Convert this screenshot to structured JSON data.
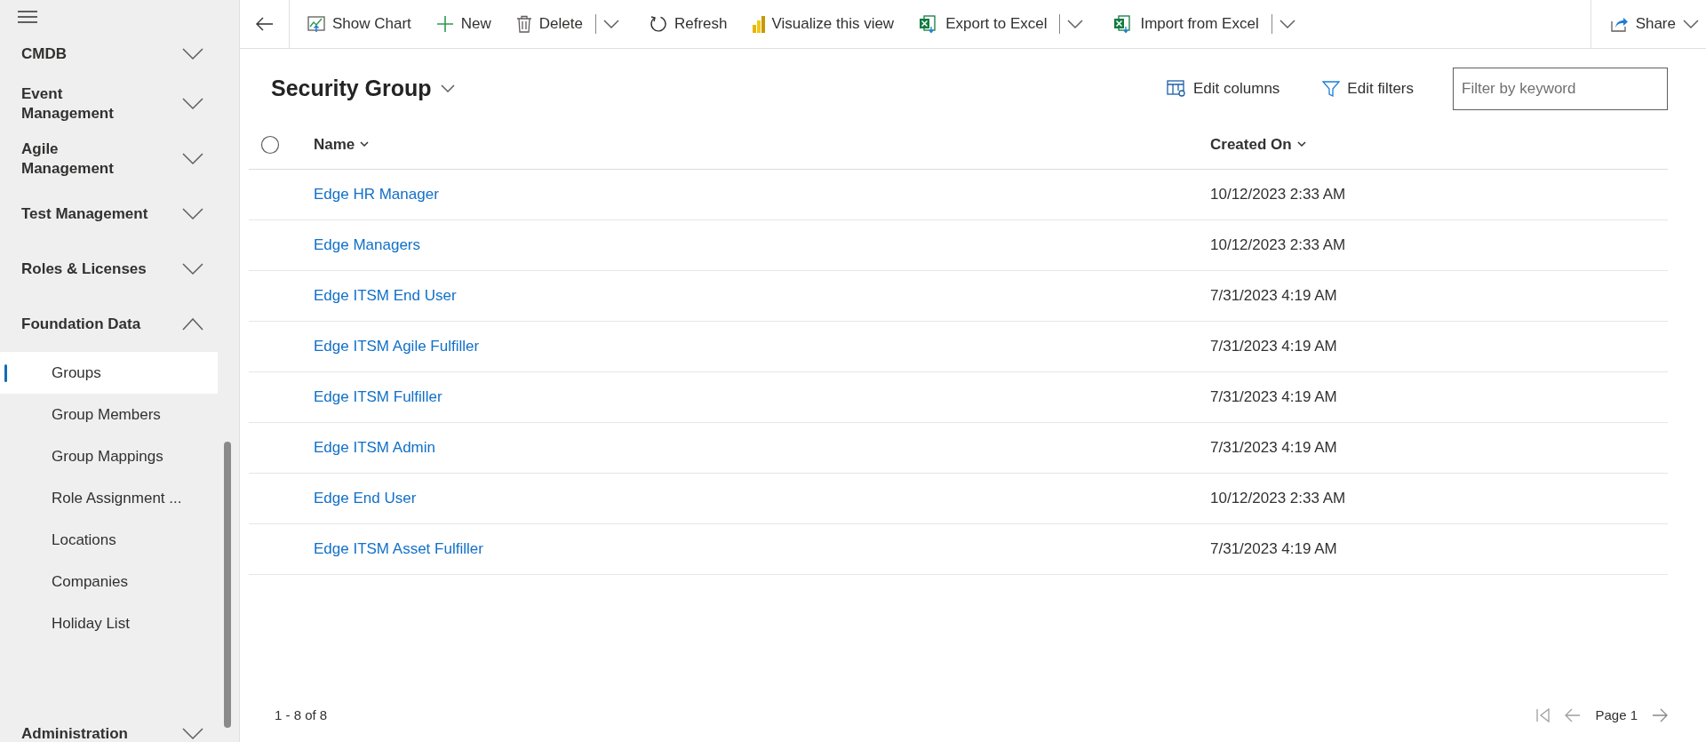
{
  "sidebar": {
    "sections": [
      {
        "label": "CMDB",
        "expanded": false
      },
      {
        "label": "Event Management",
        "expanded": false
      },
      {
        "label": "Agile Management",
        "expanded": false
      },
      {
        "label": "Test Management",
        "expanded": false
      },
      {
        "label": "Roles & Licenses",
        "expanded": false
      },
      {
        "label": "Foundation Data",
        "expanded": true,
        "children": [
          {
            "label": "Groups",
            "selected": true
          },
          {
            "label": "Group Members",
            "selected": false
          },
          {
            "label": "Group Mappings",
            "selected": false
          },
          {
            "label": "Role Assignment ...",
            "selected": false
          },
          {
            "label": "Locations",
            "selected": false
          },
          {
            "label": "Companies",
            "selected": false
          },
          {
            "label": "Holiday List",
            "selected": false
          }
        ]
      },
      {
        "label": "Administration",
        "expanded": false
      }
    ]
  },
  "toolbar": {
    "items": [
      {
        "label": "Show Chart",
        "kind": "chart",
        "split": false
      },
      {
        "label": "New",
        "kind": "plus",
        "split": false
      },
      {
        "label": "Delete",
        "kind": "trash",
        "split": true
      },
      {
        "label": "Refresh",
        "kind": "refresh",
        "split": false
      },
      {
        "label": "Visualize this view",
        "kind": "bars",
        "split": false
      },
      {
        "label": "Export to Excel",
        "kind": "excel",
        "split": true
      },
      {
        "label": "Import from Excel",
        "kind": "excel",
        "split": true
      }
    ],
    "share": {
      "label": "Share"
    }
  },
  "view": {
    "title": "Security Group",
    "actions": [
      {
        "label": "Edit columns",
        "kind": "columns"
      },
      {
        "label": "Edit filters",
        "kind": "filter"
      }
    ],
    "filter": {
      "placeholder": "Filter by keyword"
    }
  },
  "table": {
    "select_all": {
      "checked": false
    },
    "columns": [
      "Name",
      "Created On"
    ],
    "rows": [
      {
        "name": "Edge HR Manager",
        "created_on": "10/12/2023 2:33 AM"
      },
      {
        "name": "Edge Managers",
        "created_on": "10/12/2023 2:33 AM"
      },
      {
        "name": "Edge ITSM End User",
        "created_on": "7/31/2023 4:19 AM"
      },
      {
        "name": "Edge ITSM Agile Fulfiller",
        "created_on": "7/31/2023 4:19 AM"
      },
      {
        "name": "Edge ITSM Fulfiller",
        "created_on": "7/31/2023 4:19 AM"
      },
      {
        "name": "Edge ITSM Admin",
        "created_on": "7/31/2023 4:19 AM"
      },
      {
        "name": "Edge End User",
        "created_on": "10/12/2023 2:33 AM"
      },
      {
        "name": "Edge ITSM Asset Fulfiller",
        "created_on": "7/31/2023 4:19 AM"
      }
    ]
  },
  "footer": {
    "record_count": "1 - 8 of 8",
    "page": "Page 1"
  }
}
